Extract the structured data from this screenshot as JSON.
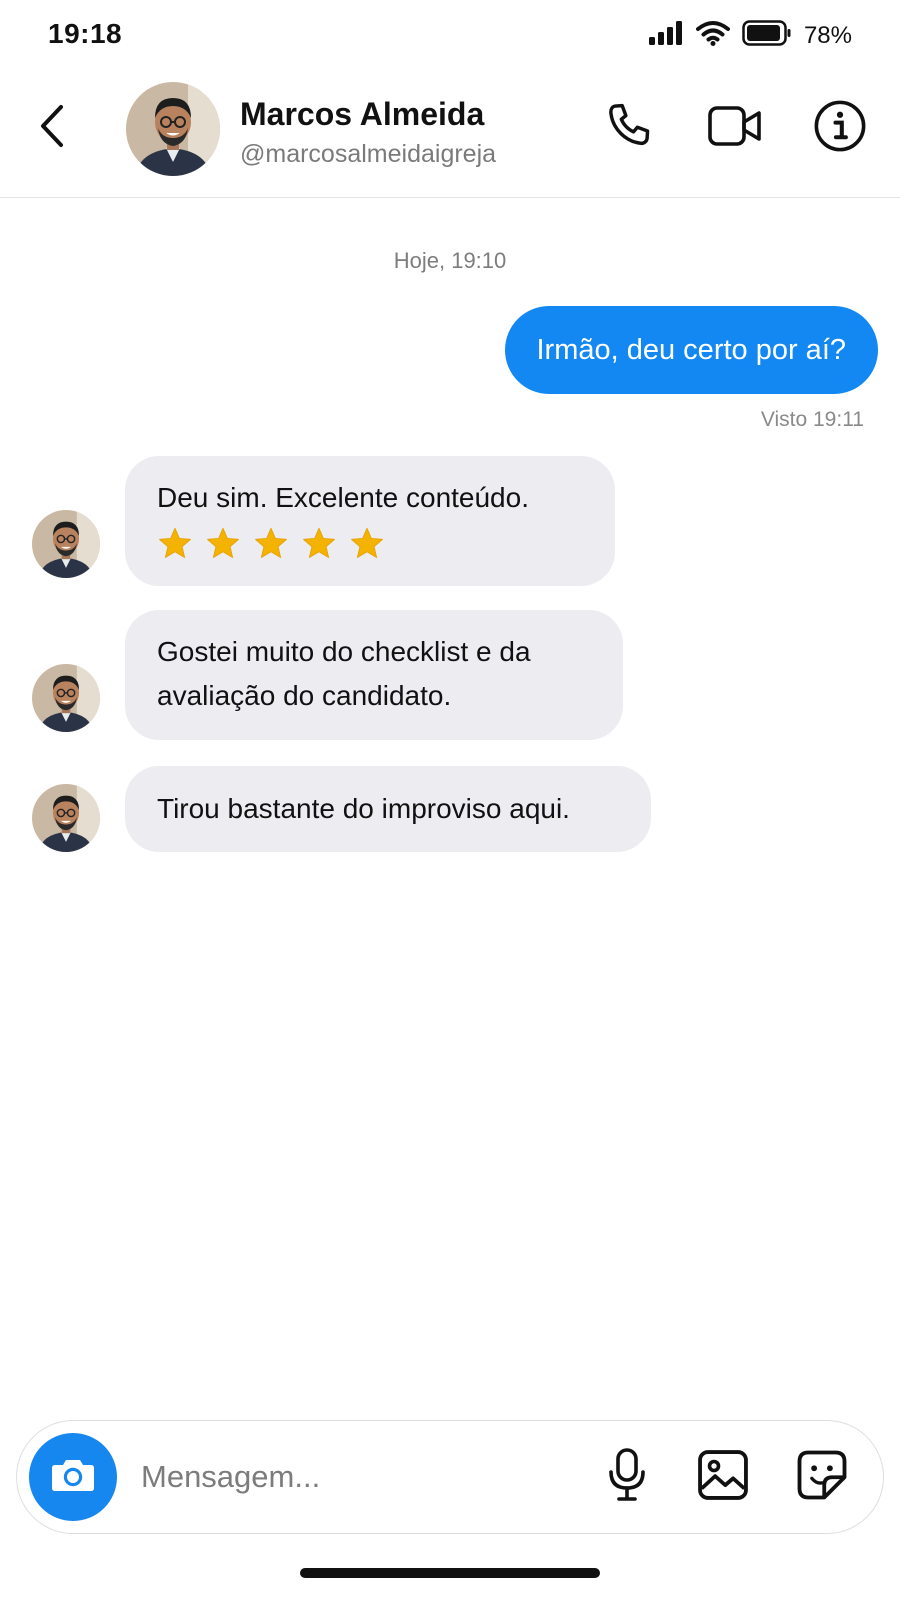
{
  "status_bar": {
    "time": "19:18",
    "battery_percent": "78%",
    "icons": [
      "cellular-signal-icon",
      "wifi-icon",
      "battery-icon"
    ]
  },
  "header": {
    "contact_name": "Marcos Almeida",
    "contact_handle": "@marcosalmeidaigreja",
    "icons": [
      "back-chevron-icon",
      "phone-icon",
      "video-camera-icon",
      "info-icon"
    ]
  },
  "chat": {
    "date_label": "Hoje, 19:10",
    "outgoing_message": "Irmão, deu certo por aí?",
    "seen_label": "Visto 19:11",
    "incoming_messages": [
      {
        "text": "Deu sim. Excelente conteúdo.",
        "stars": 5
      },
      {
        "line1": "Gostei muito do checklist e da",
        "line2": "avaliação do candidato."
      },
      {
        "text": "Tirou bastante do improviso aqui."
      }
    ]
  },
  "composer": {
    "placeholder": "Mensagem...",
    "icons": [
      "camera-icon",
      "microphone-icon",
      "image-icon",
      "sticker-icon"
    ]
  },
  "colors": {
    "accent_blue": "#1387f2",
    "incoming_bubble": "#ececf1",
    "star_yellow": "#f5b301"
  }
}
